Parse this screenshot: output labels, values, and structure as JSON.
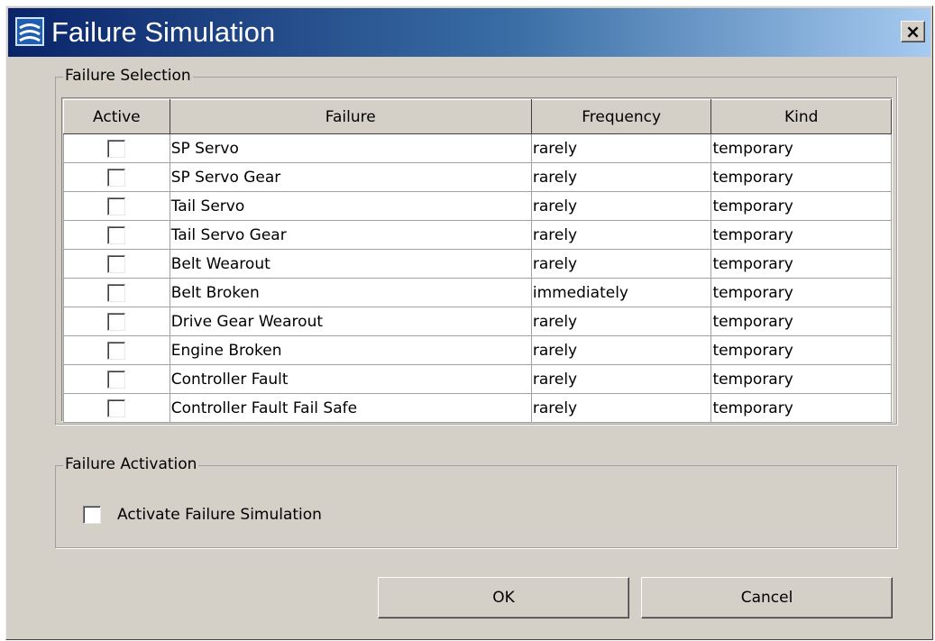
{
  "window": {
    "title": "Failure Simulation",
    "close_label": "×",
    "app_icon": "app-icon",
    "colors": {
      "titlebar_start": "#0a246a",
      "titlebar_end": "#a6caf0",
      "face": "#d4d0c8"
    }
  },
  "selection": {
    "group_title": "Failure Selection",
    "columns": [
      "Active",
      "Failure",
      "Frequency",
      "Kind"
    ],
    "rows": [
      {
        "active": false,
        "failure": "SP Servo",
        "frequency": "rarely",
        "kind": "temporary"
      },
      {
        "active": false,
        "failure": "SP Servo Gear",
        "frequency": "rarely",
        "kind": "temporary"
      },
      {
        "active": false,
        "failure": "Tail Servo",
        "frequency": "rarely",
        "kind": "temporary"
      },
      {
        "active": false,
        "failure": "Tail Servo Gear",
        "frequency": "rarely",
        "kind": "temporary"
      },
      {
        "active": false,
        "failure": "Belt Wearout",
        "frequency": "rarely",
        "kind": "temporary"
      },
      {
        "active": false,
        "failure": "Belt Broken",
        "frequency": "immediately",
        "kind": "temporary"
      },
      {
        "active": false,
        "failure": "Drive Gear Wearout",
        "frequency": "rarely",
        "kind": "temporary"
      },
      {
        "active": false,
        "failure": "Engine Broken",
        "frequency": "rarely",
        "kind": "temporary"
      },
      {
        "active": false,
        "failure": "Controller Fault",
        "frequency": "rarely",
        "kind": "temporary"
      },
      {
        "active": false,
        "failure": "Controller Fault Fail Safe",
        "frequency": "rarely",
        "kind": "temporary"
      }
    ]
  },
  "activation": {
    "group_title": "Failure Activation",
    "checkbox_label": "Activate Failure Simulation",
    "checked": false
  },
  "buttons": {
    "ok_label": "OK",
    "cancel_label": "Cancel"
  }
}
